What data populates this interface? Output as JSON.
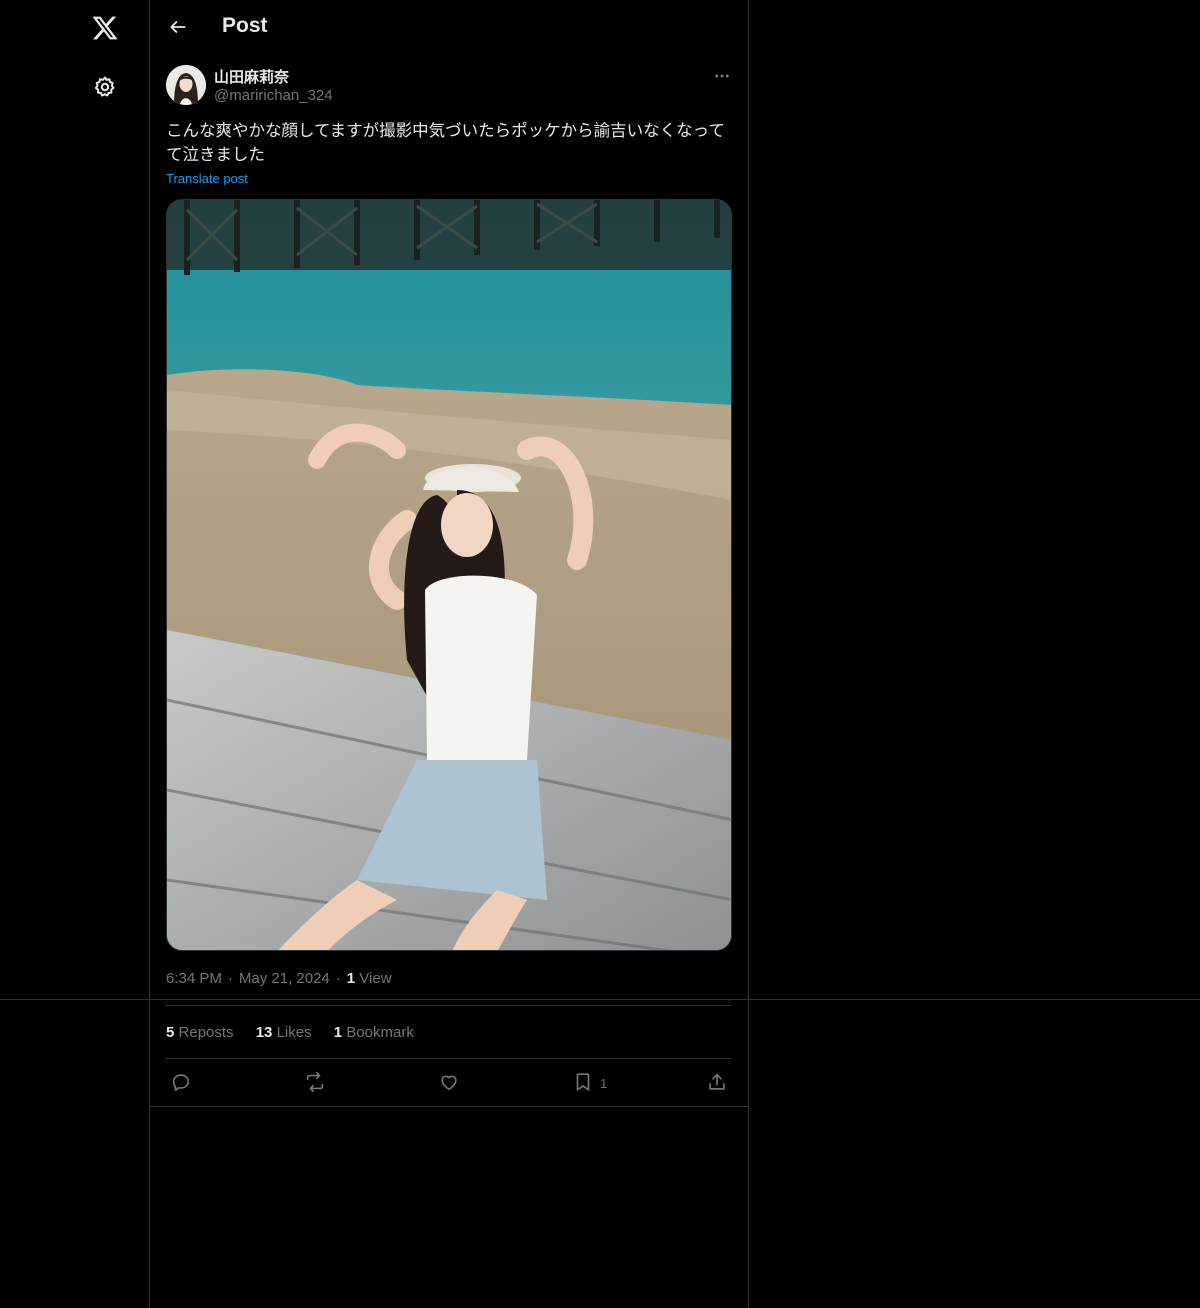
{
  "icons": {
    "logo": "x-logo-icon",
    "settings": "gear-icon",
    "back": "back-arrow-icon",
    "more": "more-dots-icon",
    "reply": "reply-icon",
    "repost": "repost-icon",
    "like": "heart-icon",
    "bookmark": "bookmark-icon",
    "share": "share-icon"
  },
  "colors": {
    "background": "#000000",
    "text": "#e7e9ea",
    "muted": "#71767b",
    "accent": "#1d9bf0",
    "border": "#2f3336"
  },
  "header": {
    "title": "Post"
  },
  "post": {
    "author_name": "山田麻莉奈",
    "author_handle": "@maririchan_324",
    "text": "こんな爽やかな顔してますが撮影中気づいたらポッケから諭吉いなくなってて泣きました",
    "translate_label": "Translate post",
    "time": "6:34 PM",
    "date": "May 21, 2024",
    "views_count": "1",
    "views_label": "View",
    "reposts_count": "5",
    "reposts_label": "Reposts",
    "likes_count": "13",
    "likes_label": "Likes",
    "bookmarks_count": "1",
    "bookmarks_label": "Bookmark",
    "bookmark_action_count": "1"
  }
}
